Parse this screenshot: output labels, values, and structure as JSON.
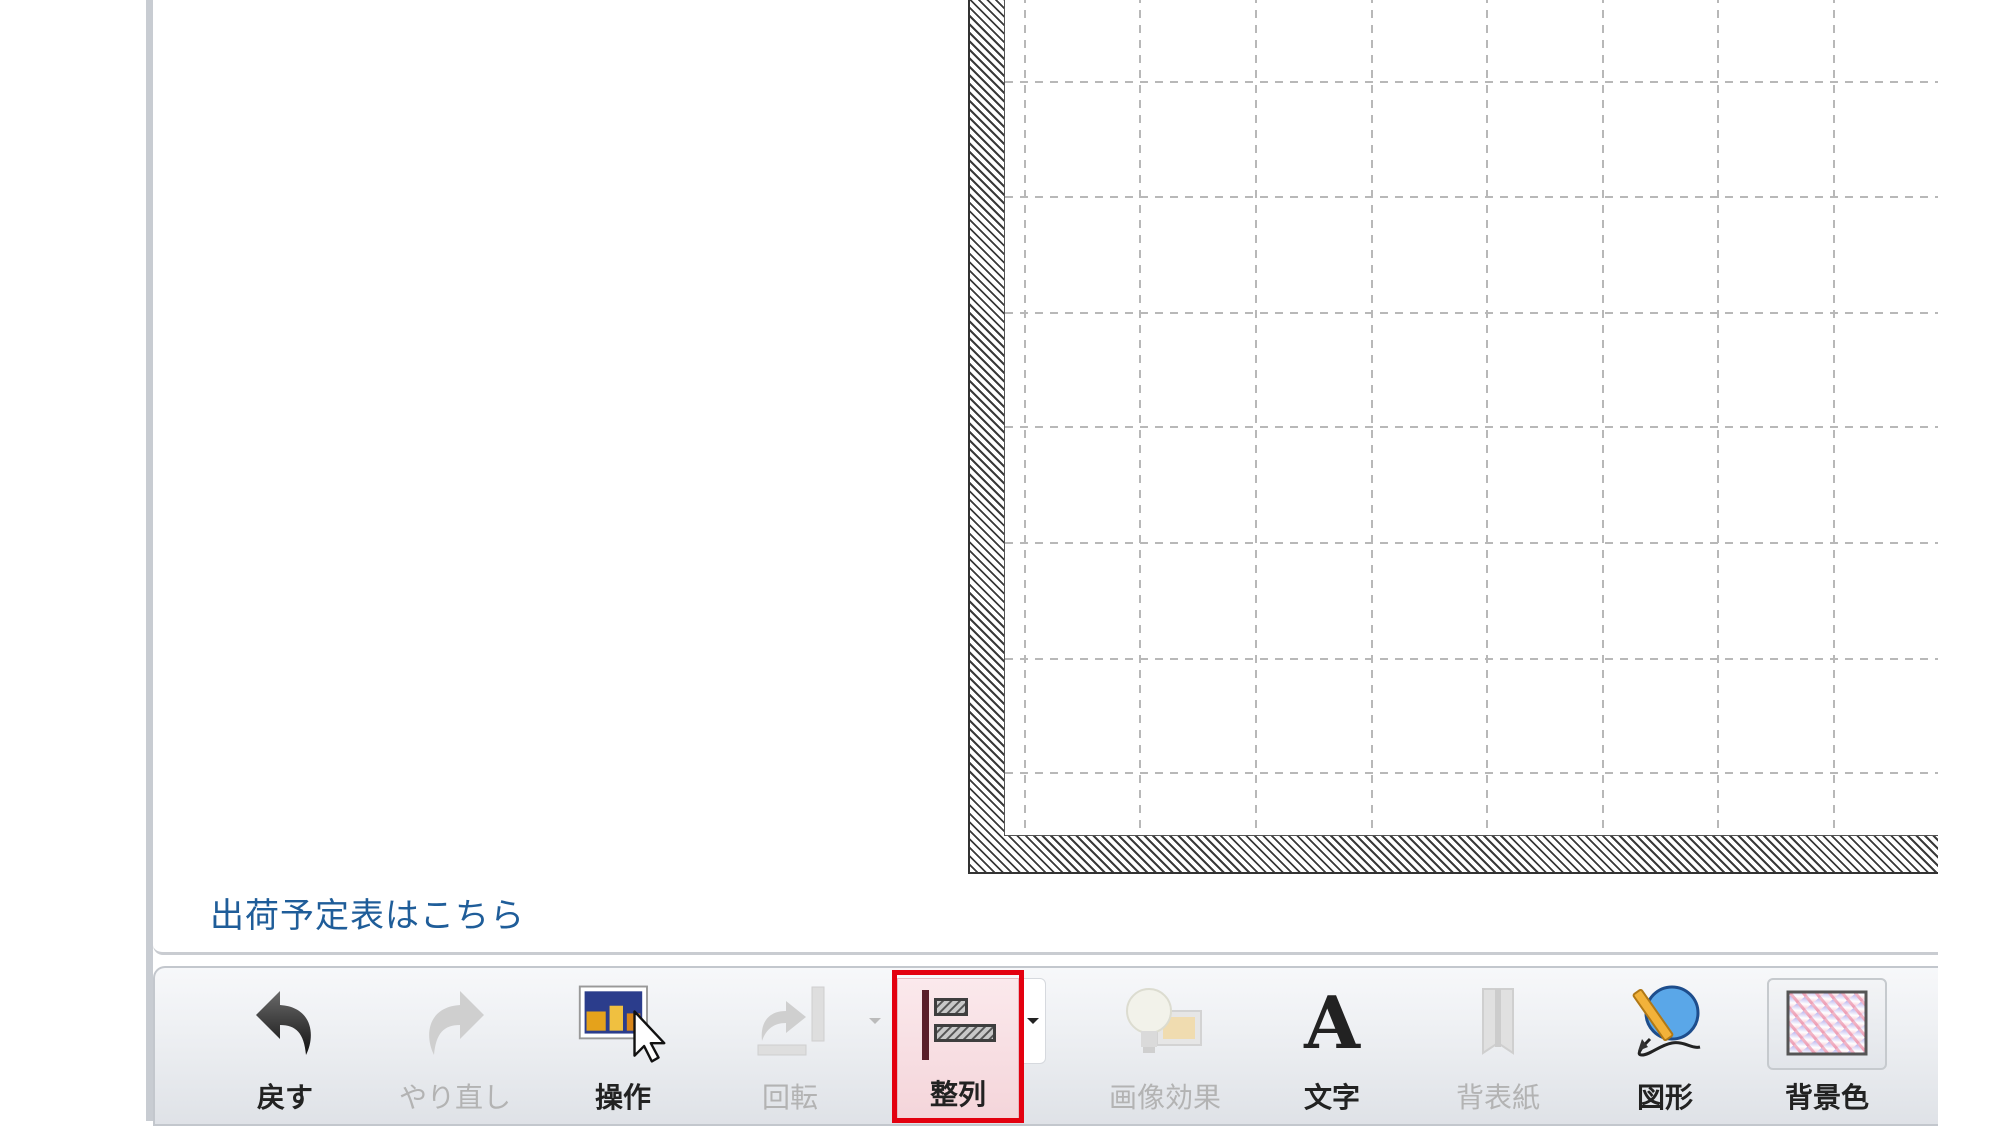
{
  "link": {
    "shipping_schedule": "出荷予定表はこちら"
  },
  "toolbar": {
    "undo": "戻す",
    "redo": "やり直し",
    "operate": "操作",
    "rotate": "回転",
    "align": "整列",
    "image_effects": "画像効果",
    "text": "文字",
    "cover": "背表紙",
    "shape": "図形",
    "background_color": "背景色"
  },
  "icons": {
    "undo": "undo-arrow-icon",
    "redo": "redo-arrow-icon",
    "operate": "photo-cursor-icon",
    "rotate": "rotate-icon",
    "align": "align-left-icon",
    "image_effects": "lightbulb-photo-icon",
    "text": "letter-a-icon",
    "cover": "book-spine-icon",
    "shape": "pencil-globe-icon",
    "background_color": "gradient-swatch-icon"
  },
  "colors": {
    "highlight": "#e3000f",
    "link": "#1f5d99",
    "disabled_text": "#b3b3b3"
  }
}
